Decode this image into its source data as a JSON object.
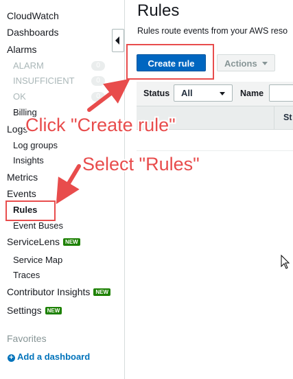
{
  "sidebar": {
    "items": [
      {
        "label": "CloudWatch"
      },
      {
        "label": "Dashboards"
      },
      {
        "label": "Alarms"
      },
      {
        "label": "ALARM",
        "count": "0"
      },
      {
        "label": "INSUFFICIENT",
        "count": "0"
      },
      {
        "label": "OK",
        "count": "0"
      },
      {
        "label": "Billing"
      },
      {
        "label": "Logs"
      },
      {
        "label": "Log groups"
      },
      {
        "label": "Insights"
      },
      {
        "label": "Metrics"
      },
      {
        "label": "Events"
      },
      {
        "label": "Rules"
      },
      {
        "label": "Event Buses"
      },
      {
        "label": "ServiceLens",
        "badge": "NEW"
      },
      {
        "label": "Service Map"
      },
      {
        "label": "Traces"
      },
      {
        "label": "Contributor Insights",
        "badge": "NEW"
      },
      {
        "label": "Settings",
        "badge": "NEW"
      }
    ],
    "favorites_title": "Favorites",
    "add_dashboard_label": "Add a dashboard"
  },
  "main": {
    "title": "Rules",
    "description": "Rules route events from your AWS reso",
    "create_rule_label": "Create rule",
    "actions_label": "Actions",
    "filter": {
      "status_label": "Status",
      "status_value": "All",
      "name_label": "Name"
    },
    "table": {
      "column_status": "St"
    }
  },
  "annotations": {
    "click_create": "Click \"Create rule\"",
    "select_rules": "Select \"Rules\""
  },
  "colors": {
    "primary_button": "#0066c0",
    "annotation": "#e84c4c",
    "new_badge": "#1d8102",
    "link": "#0073bb"
  }
}
